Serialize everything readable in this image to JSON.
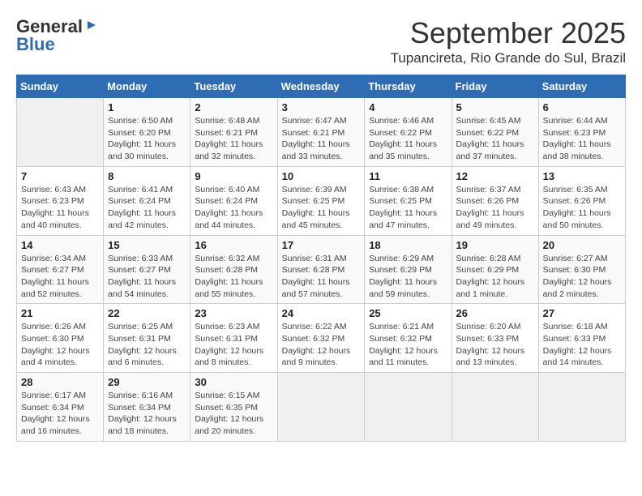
{
  "logo": {
    "general": "General",
    "blue": "Blue"
  },
  "title": "September 2025",
  "subtitle": "Tupancireta, Rio Grande do Sul, Brazil",
  "days_of_week": [
    "Sunday",
    "Monday",
    "Tuesday",
    "Wednesday",
    "Thursday",
    "Friday",
    "Saturday"
  ],
  "weeks": [
    [
      {
        "num": "",
        "detail": ""
      },
      {
        "num": "1",
        "detail": "Sunrise: 6:50 AM\nSunset: 6:20 PM\nDaylight: 11 hours\nand 30 minutes."
      },
      {
        "num": "2",
        "detail": "Sunrise: 6:48 AM\nSunset: 6:21 PM\nDaylight: 11 hours\nand 32 minutes."
      },
      {
        "num": "3",
        "detail": "Sunrise: 6:47 AM\nSunset: 6:21 PM\nDaylight: 11 hours\nand 33 minutes."
      },
      {
        "num": "4",
        "detail": "Sunrise: 6:46 AM\nSunset: 6:22 PM\nDaylight: 11 hours\nand 35 minutes."
      },
      {
        "num": "5",
        "detail": "Sunrise: 6:45 AM\nSunset: 6:22 PM\nDaylight: 11 hours\nand 37 minutes."
      },
      {
        "num": "6",
        "detail": "Sunrise: 6:44 AM\nSunset: 6:23 PM\nDaylight: 11 hours\nand 38 minutes."
      }
    ],
    [
      {
        "num": "7",
        "detail": "Sunrise: 6:43 AM\nSunset: 6:23 PM\nDaylight: 11 hours\nand 40 minutes."
      },
      {
        "num": "8",
        "detail": "Sunrise: 6:41 AM\nSunset: 6:24 PM\nDaylight: 11 hours\nand 42 minutes."
      },
      {
        "num": "9",
        "detail": "Sunrise: 6:40 AM\nSunset: 6:24 PM\nDaylight: 11 hours\nand 44 minutes."
      },
      {
        "num": "10",
        "detail": "Sunrise: 6:39 AM\nSunset: 6:25 PM\nDaylight: 11 hours\nand 45 minutes."
      },
      {
        "num": "11",
        "detail": "Sunrise: 6:38 AM\nSunset: 6:25 PM\nDaylight: 11 hours\nand 47 minutes."
      },
      {
        "num": "12",
        "detail": "Sunrise: 6:37 AM\nSunset: 6:26 PM\nDaylight: 11 hours\nand 49 minutes."
      },
      {
        "num": "13",
        "detail": "Sunrise: 6:35 AM\nSunset: 6:26 PM\nDaylight: 11 hours\nand 50 minutes."
      }
    ],
    [
      {
        "num": "14",
        "detail": "Sunrise: 6:34 AM\nSunset: 6:27 PM\nDaylight: 11 hours\nand 52 minutes."
      },
      {
        "num": "15",
        "detail": "Sunrise: 6:33 AM\nSunset: 6:27 PM\nDaylight: 11 hours\nand 54 minutes."
      },
      {
        "num": "16",
        "detail": "Sunrise: 6:32 AM\nSunset: 6:28 PM\nDaylight: 11 hours\nand 55 minutes."
      },
      {
        "num": "17",
        "detail": "Sunrise: 6:31 AM\nSunset: 6:28 PM\nDaylight: 11 hours\nand 57 minutes."
      },
      {
        "num": "18",
        "detail": "Sunrise: 6:29 AM\nSunset: 6:29 PM\nDaylight: 11 hours\nand 59 minutes."
      },
      {
        "num": "19",
        "detail": "Sunrise: 6:28 AM\nSunset: 6:29 PM\nDaylight: 12 hours\nand 1 minute."
      },
      {
        "num": "20",
        "detail": "Sunrise: 6:27 AM\nSunset: 6:30 PM\nDaylight: 12 hours\nand 2 minutes."
      }
    ],
    [
      {
        "num": "21",
        "detail": "Sunrise: 6:26 AM\nSunset: 6:30 PM\nDaylight: 12 hours\nand 4 minutes."
      },
      {
        "num": "22",
        "detail": "Sunrise: 6:25 AM\nSunset: 6:31 PM\nDaylight: 12 hours\nand 6 minutes."
      },
      {
        "num": "23",
        "detail": "Sunrise: 6:23 AM\nSunset: 6:31 PM\nDaylight: 12 hours\nand 8 minutes."
      },
      {
        "num": "24",
        "detail": "Sunrise: 6:22 AM\nSunset: 6:32 PM\nDaylight: 12 hours\nand 9 minutes."
      },
      {
        "num": "25",
        "detail": "Sunrise: 6:21 AM\nSunset: 6:32 PM\nDaylight: 12 hours\nand 11 minutes."
      },
      {
        "num": "26",
        "detail": "Sunrise: 6:20 AM\nSunset: 6:33 PM\nDaylight: 12 hours\nand 13 minutes."
      },
      {
        "num": "27",
        "detail": "Sunrise: 6:18 AM\nSunset: 6:33 PM\nDaylight: 12 hours\nand 14 minutes."
      }
    ],
    [
      {
        "num": "28",
        "detail": "Sunrise: 6:17 AM\nSunset: 6:34 PM\nDaylight: 12 hours\nand 16 minutes."
      },
      {
        "num": "29",
        "detail": "Sunrise: 6:16 AM\nSunset: 6:34 PM\nDaylight: 12 hours\nand 18 minutes."
      },
      {
        "num": "30",
        "detail": "Sunrise: 6:15 AM\nSunset: 6:35 PM\nDaylight: 12 hours\nand 20 minutes."
      },
      {
        "num": "",
        "detail": ""
      },
      {
        "num": "",
        "detail": ""
      },
      {
        "num": "",
        "detail": ""
      },
      {
        "num": "",
        "detail": ""
      }
    ]
  ]
}
